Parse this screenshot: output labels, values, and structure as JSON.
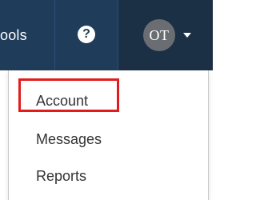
{
  "navbar": {
    "tools_label": "ools",
    "help_icon": "question-circle-icon",
    "help_glyph": "?",
    "user": {
      "initials": "OT",
      "caret_icon": "caret-down-icon"
    }
  },
  "dropdown": {
    "items": [
      {
        "label": "Account",
        "highlighted": true
      },
      {
        "label": "Messages"
      },
      {
        "label": "Reports"
      }
    ]
  },
  "colors": {
    "navbar_bg": "#1f3c5a",
    "user_bg": "#1b2f45",
    "avatar_bg": "#6a6e73",
    "highlight": "#e41b1b",
    "menu_text": "#333333"
  }
}
